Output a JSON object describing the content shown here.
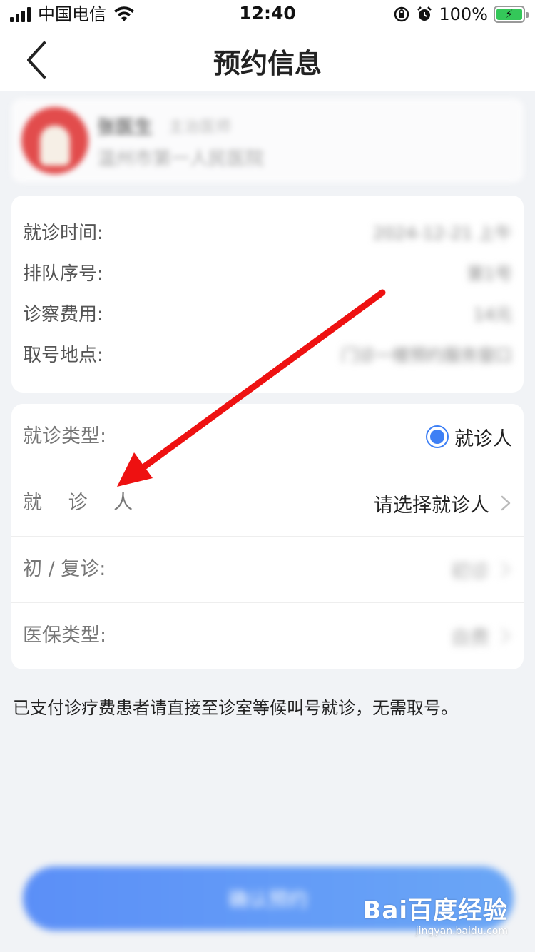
{
  "status_bar": {
    "carrier": "中国电信",
    "time": "12:40",
    "battery": "100%"
  },
  "nav": {
    "title": "预约信息"
  },
  "doctor": {
    "name": "张医生",
    "title": "主治医师",
    "hospital": "温州市第一人民医院"
  },
  "info": {
    "rows": [
      {
        "label": "就诊时间:",
        "value": "2024-12-21 上午"
      },
      {
        "label": "排队序号:",
        "value": "第1号"
      },
      {
        "label": "诊察费用:",
        "value": "14元"
      },
      {
        "label": "取号地点:",
        "value": "门诊一楼预约服务窗口"
      }
    ]
  },
  "form": {
    "visit_type_label": "就诊类型:",
    "visit_type_option": "就诊人",
    "patient_label": "就 诊 人",
    "patient_placeholder": "请选择就诊人",
    "first_visit_label": "初 / 复诊:",
    "first_visit_value": "初诊",
    "insurance_label": "医保类型:",
    "insurance_value": "自费"
  },
  "notice": "已支付诊疗费患者请直接至诊室等候叫号就诊，无需取号。",
  "confirm_button": "确认预约",
  "watermark": {
    "logo": "Bai百度经验",
    "url": "jingyan.baidu.com"
  },
  "colors": {
    "accent": "#3d7ff5",
    "annotation_arrow": "#ee1111",
    "battery": "#34c759"
  }
}
